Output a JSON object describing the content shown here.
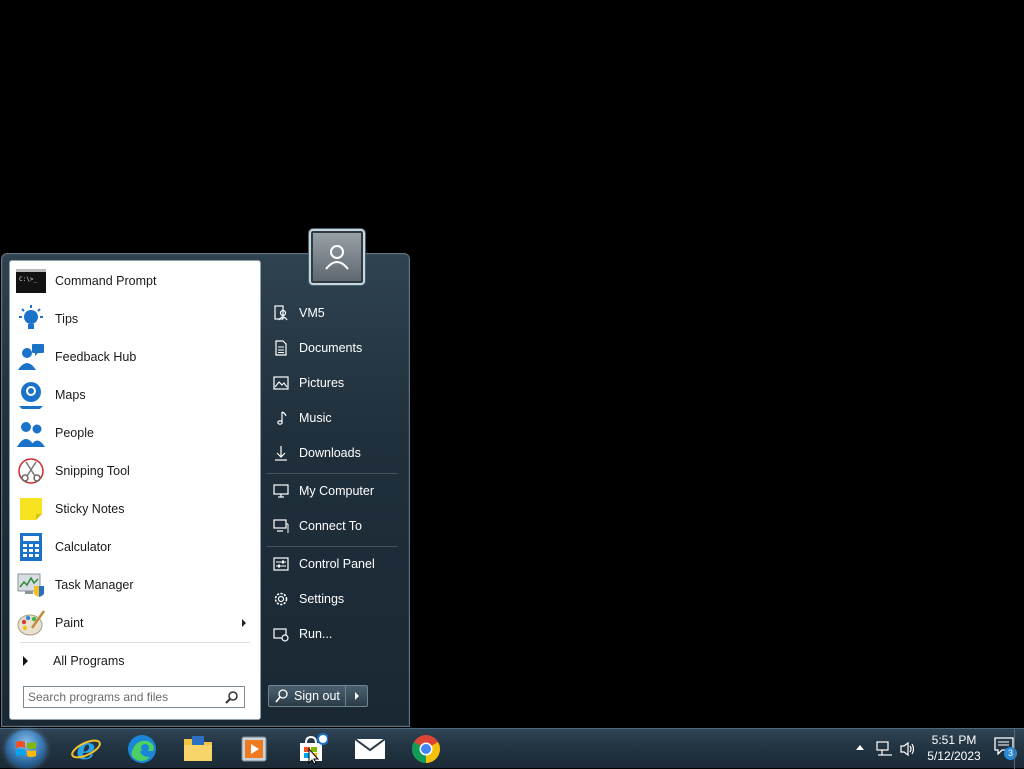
{
  "start_menu": {
    "programs": [
      {
        "label": "Command Prompt",
        "icon": "command-prompt-icon"
      },
      {
        "label": "Tips",
        "icon": "tips-icon"
      },
      {
        "label": "Feedback Hub",
        "icon": "feedback-hub-icon"
      },
      {
        "label": "Maps",
        "icon": "maps-icon"
      },
      {
        "label": "People",
        "icon": "people-icon"
      },
      {
        "label": "Snipping Tool",
        "icon": "snipping-tool-icon"
      },
      {
        "label": "Sticky Notes",
        "icon": "sticky-notes-icon"
      },
      {
        "label": "Calculator",
        "icon": "calculator-icon"
      },
      {
        "label": "Task Manager",
        "icon": "task-manager-icon"
      },
      {
        "label": "Paint",
        "icon": "paint-icon",
        "has_submenu": true
      }
    ],
    "all_programs_label": "All Programs",
    "search_placeholder": "Search programs and files",
    "right_items": [
      {
        "label": "VM5",
        "icon": "user-folder-icon"
      },
      {
        "label": "Documents",
        "icon": "documents-icon"
      },
      {
        "label": "Pictures",
        "icon": "pictures-icon"
      },
      {
        "label": "Music",
        "icon": "music-icon"
      },
      {
        "label": "Downloads",
        "icon": "downloads-icon"
      },
      {
        "label": "My Computer",
        "icon": "computer-icon"
      },
      {
        "label": "Connect To",
        "icon": "connect-to-icon"
      },
      {
        "label": "Control Panel",
        "icon": "control-panel-icon"
      },
      {
        "label": "Settings",
        "icon": "settings-gear-icon"
      },
      {
        "label": "Run...",
        "icon": "run-icon"
      }
    ],
    "sign_out_label": "Sign out"
  },
  "taskbar": {
    "pinned": [
      {
        "icon": "internet-explorer-icon"
      },
      {
        "icon": "edge-icon"
      },
      {
        "icon": "file-explorer-icon"
      },
      {
        "icon": "media-player-icon"
      },
      {
        "icon": "store-icon"
      },
      {
        "icon": "mail-icon"
      },
      {
        "icon": "chrome-icon"
      }
    ],
    "clock_time": "5:51 PM",
    "clock_date": "5/12/2023",
    "notification_count": "3"
  },
  "colors": {
    "accent_blue": "#1a73c9",
    "taskbar": "#213341",
    "menu_frame": "#2f4250"
  }
}
